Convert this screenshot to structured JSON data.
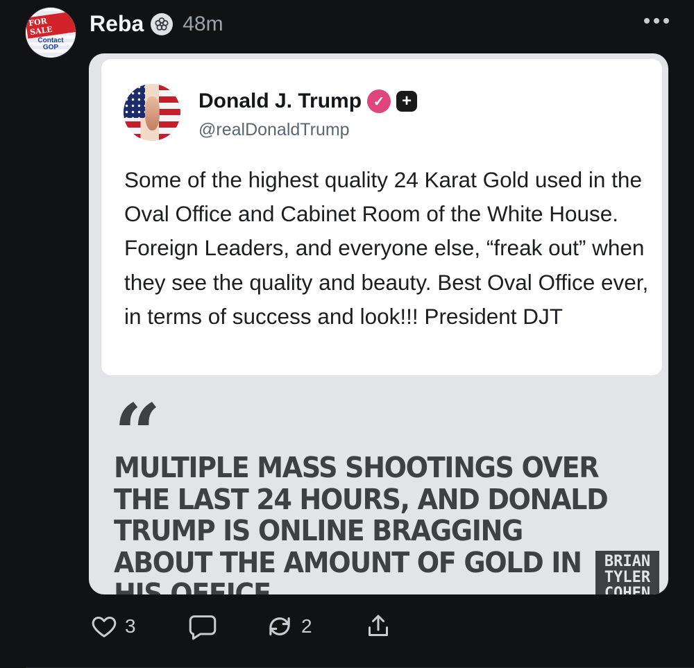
{
  "post": {
    "author": "Reba",
    "timestamp": "48m",
    "avatar_text": {
      "sale": "FOR SALE",
      "contact_line1": "Contact",
      "contact_line2": "GOP"
    }
  },
  "embedded_tweet": {
    "display_name": "Donald J. Trump",
    "handle": "@realDonaldTrump",
    "body": "Some of the highest quality 24 Karat Gold used in the Oval Office and Cabinet Room of the White House. Foreign Leaders, and everyone else, “freak out” when they see the quality and beauty. Best Oval Office ever, in terms of success and look!!! President DJT",
    "verified_color": "#e0457b"
  },
  "quote_card": {
    "quote_mark": "“",
    "headline": "MULTIPLE MASS SHOOTINGS OVER THE LAST 24 HOURS, AND DONALD TRUMP IS ONLINE BRAGGING ABOUT THE AMOUNT OF GOLD IN HIS OFFICE.",
    "brand_lines": [
      "BRIAN",
      "TYLER",
      "COHEN"
    ]
  },
  "actions": {
    "like_count": "3",
    "reply_count": "",
    "repost_count": "2"
  },
  "icons": [
    "flower-badge-icon",
    "more-icon",
    "heart-icon",
    "reply-icon",
    "repost-icon",
    "share-icon",
    "verified-icon",
    "plus-icon"
  ],
  "colors": {
    "background": "#101214",
    "text": "#f2f3f5",
    "muted": "#9da3ab"
  }
}
